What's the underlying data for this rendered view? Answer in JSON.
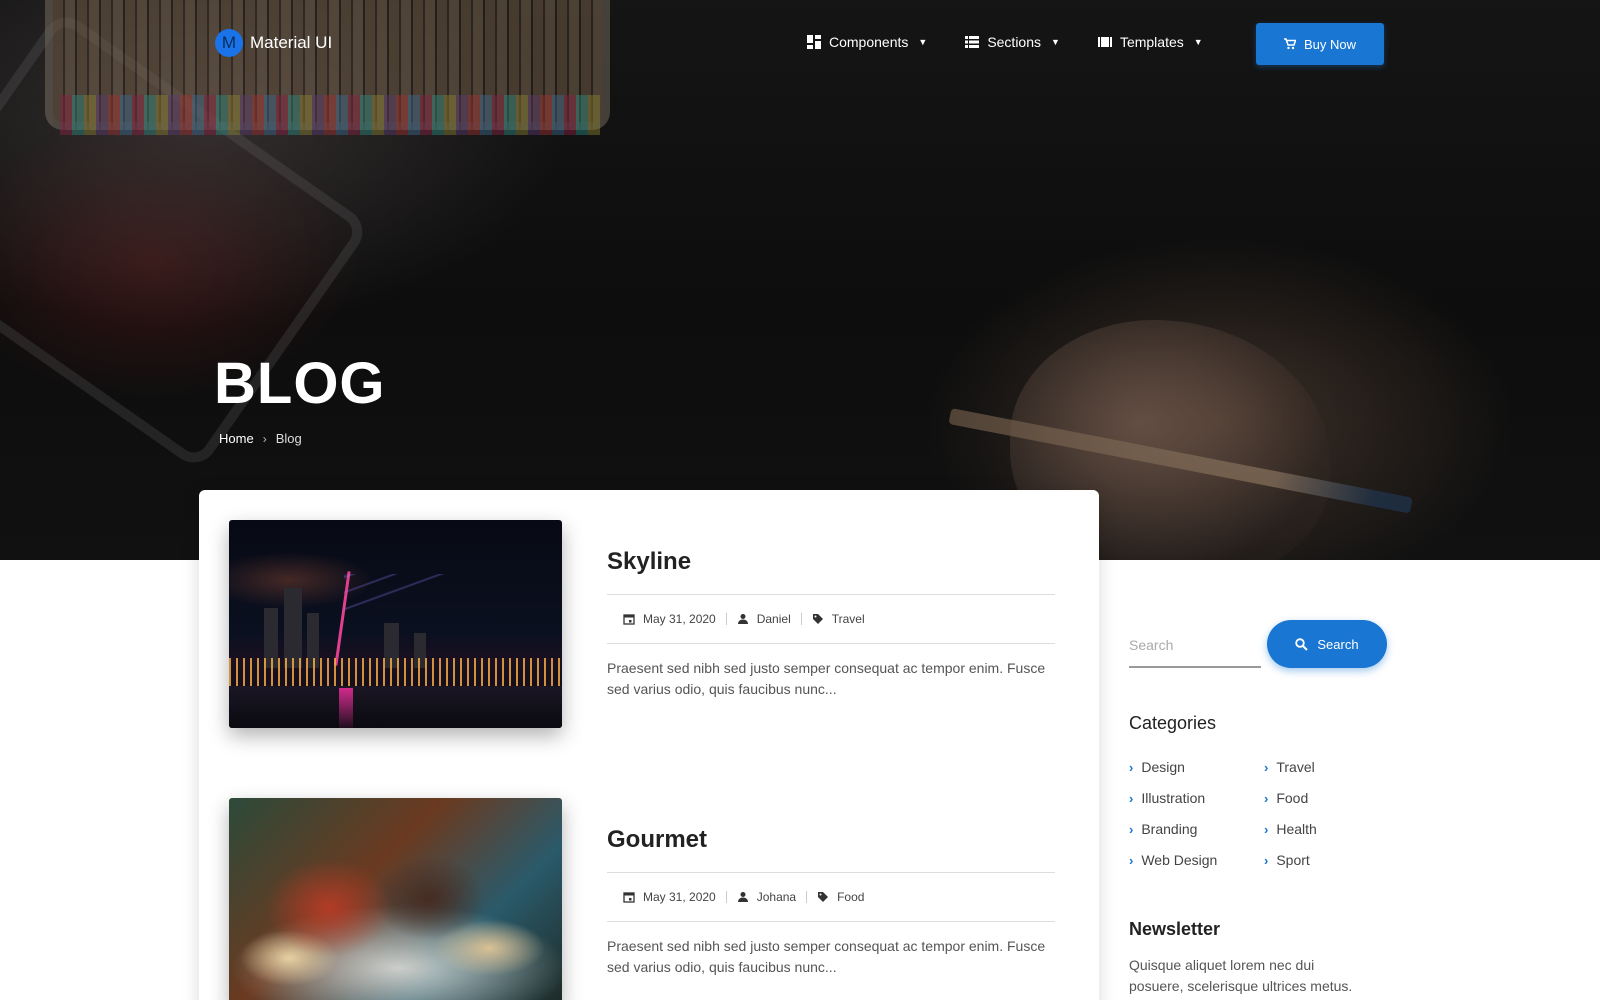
{
  "brand": {
    "logo_letter": "M",
    "name": "Material UI"
  },
  "nav": {
    "items": [
      {
        "label": "Components",
        "icon": "dashboard-icon"
      },
      {
        "label": "Sections",
        "icon": "list-icon"
      },
      {
        "label": "Templates",
        "icon": "view-columns-icon"
      }
    ],
    "buy_label": "Buy Now"
  },
  "hero": {
    "title": "BLOG",
    "breadcrumb": {
      "home": "Home",
      "current": "Blog"
    }
  },
  "posts": [
    {
      "title": "Skyline",
      "date": "May 31, 2020",
      "author": "Daniel",
      "category": "Travel",
      "excerpt": "Praesent sed nibh sed justo semper consequat ac tempor enim. Fusce sed varius odio, quis faucibus nunc..."
    },
    {
      "title": "Gourmet",
      "date": "May 31, 2020",
      "author": "Johana",
      "category": "Food",
      "excerpt": "Praesent sed nibh sed justo semper consequat ac tempor enim. Fusce sed varius odio, quis faucibus nunc..."
    }
  ],
  "sidebar": {
    "search": {
      "placeholder": "Search",
      "button_label": "Search"
    },
    "categories": {
      "heading": "Categories",
      "items": [
        "Design",
        "Travel",
        "Illustration",
        "Food",
        "Branding",
        "Health",
        "Web Design",
        "Sport"
      ]
    },
    "newsletter": {
      "heading": "Newsletter",
      "text": "Quisque aliquet lorem nec dui posuere, scelerisque ultrices metus."
    }
  },
  "colors": {
    "accent": "#1976d2",
    "hero_bg": "#111111"
  }
}
